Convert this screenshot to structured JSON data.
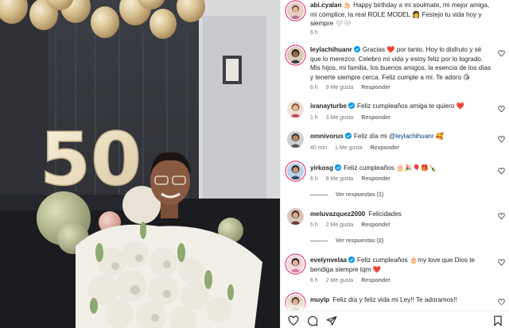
{
  "photo": {
    "balloon_number": "50",
    "alt": ""
  },
  "colors": {
    "verified": "#0095f6",
    "mention": "#00376b",
    "meta": "#737373",
    "heart_filled": "#ed4956",
    "ring": "#e1306c"
  },
  "comments": [
    {
      "user": "abi.cyalan",
      "text": "🎂 Happy birthday a mi soulmate, mi mejor amiga, mi cómplice, la real ROLE MODEL 👩 Festejo tu vida hoy y siempre 🤍🤍",
      "time": "6 h",
      "likes": "",
      "reply": "",
      "verified": false
    },
    {
      "user": "leylachihuanr",
      "text": "Gracias ❤️ por tanto. Hoy lo disfruto y sé que lo merezco. Celebro mi vida y estoy feliz por lo logrado. Mis hijos, mi familia, los buenos amigos, la esencia de los días y tenerte siempre cerca. Feliz cumple a mi. Te adoro 😘",
      "time": "6 h",
      "likes": "9 Me gusta",
      "reply": "Responder",
      "verified": true
    },
    {
      "user": "ivanayturbe",
      "text": "Feliz cumpleaños amiga te quiero ❤️",
      "time": "1 h",
      "likes": "3 Me gusta",
      "reply": "Responder",
      "verified": true
    },
    {
      "user": "omnivorus",
      "text_prefix": "Feliz día mi ",
      "mention": "@leylachihuanr",
      "text_suffix": " 🥰",
      "time": "40 min",
      "likes": "1 Me gusta",
      "reply": "Responder",
      "verified": true
    },
    {
      "user": "yirkosg",
      "text": "Feliz cumpleaños 🎂🎉🎈🎁🍾",
      "time": "6 h",
      "likes": "8 Me gusta",
      "reply": "Responder",
      "verified": true,
      "view_replies": "Ver respuestas (1)"
    },
    {
      "user": "meluvazquez2000",
      "text": "Felicidades",
      "time": "6 h",
      "likes": "2 Me gusta",
      "reply": "Responder",
      "verified": false,
      "view_replies": "Ver respuestas (2)"
    },
    {
      "user": "evelynvelaa",
      "text": "Feliz cumpleaños 🎂my love que Dios te bendiga siempre tqm ❤️",
      "time": "6 h",
      "likes": "2 Me gusta",
      "reply": "Responder",
      "verified": true
    },
    {
      "user": "muylp",
      "text": "Feliz día y feliz vida mi Ley!! Te adoramos!!",
      "time": "",
      "likes": "",
      "reply": "",
      "verified": false
    }
  ],
  "actions": [
    "heart-icon",
    "comment-icon",
    "share-icon",
    "bookmark-icon"
  ]
}
